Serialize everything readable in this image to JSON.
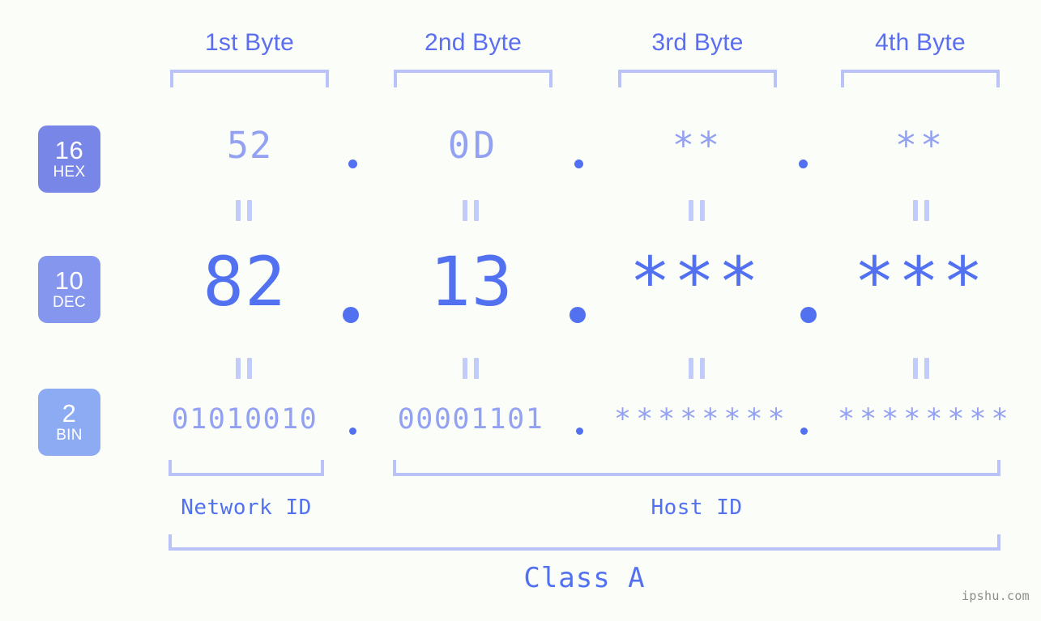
{
  "background_color": "#fbfdf8",
  "accent_colors": {
    "strong_blue": "#5271f0",
    "light_blue": "#93a1f2",
    "bracket_blue": "#b9c3f7",
    "badge_hex": "#7886e8",
    "badge_dec": "#8496ee",
    "badge_bin": "#8cabf3"
  },
  "byte_headers": [
    {
      "label": "1st Byte"
    },
    {
      "label": "2nd Byte"
    },
    {
      "label": "3rd Byte"
    },
    {
      "label": "4th Byte"
    }
  ],
  "bases": [
    {
      "number": "16",
      "name": "HEX"
    },
    {
      "number": "10",
      "name": "DEC"
    },
    {
      "number": "2",
      "name": "BIN"
    }
  ],
  "rows": {
    "hex": {
      "bytes": [
        "52",
        "0D",
        "**",
        "**"
      ]
    },
    "dec": {
      "bytes": [
        "82",
        "13",
        "***",
        "***"
      ]
    },
    "bin": {
      "bytes": [
        "01010010",
        "00001101",
        "********",
        "********"
      ]
    }
  },
  "separators": {
    "dot": ".",
    "equals": "="
  },
  "sections": [
    {
      "label": "Network ID"
    },
    {
      "label": "Host ID"
    }
  ],
  "class": {
    "label": "Class A"
  },
  "watermark": {
    "text": "ipshu.com"
  }
}
